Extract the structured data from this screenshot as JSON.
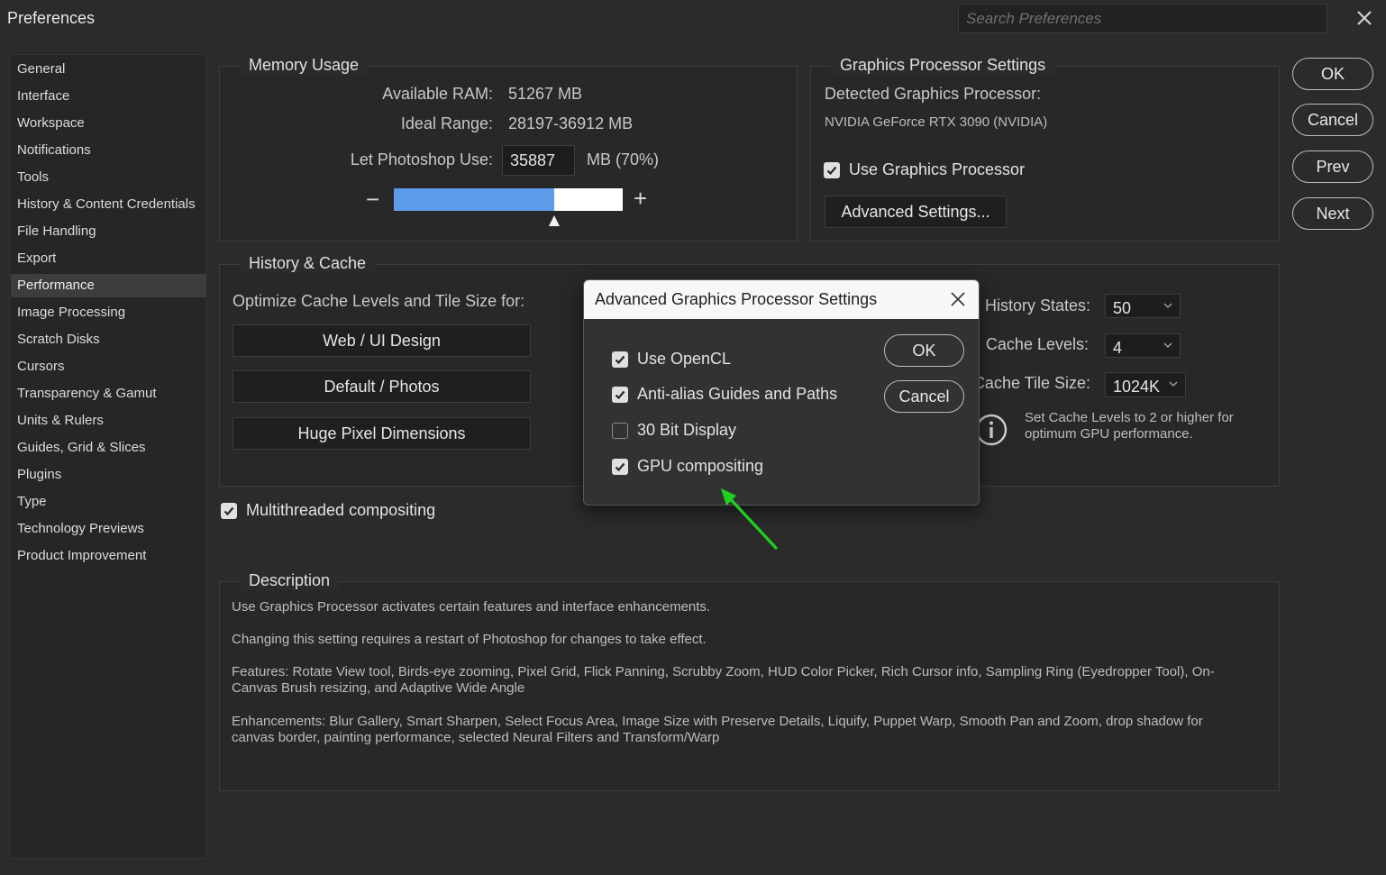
{
  "window": {
    "title": "Preferences",
    "search_placeholder": "Search Preferences"
  },
  "sidebar": {
    "items": [
      "General",
      "Interface",
      "Workspace",
      "Notifications",
      "Tools",
      "History & Content Credentials",
      "File Handling",
      "Export",
      "Performance",
      "Image Processing",
      "Scratch Disks",
      "Cursors",
      "Transparency & Gamut",
      "Units & Rulers",
      "Guides, Grid & Slices",
      "Plugins",
      "Type",
      "Technology Previews",
      "Product Improvement"
    ],
    "active": "Performance"
  },
  "memory": {
    "legend": "Memory Usage",
    "available_label": "Available RAM:",
    "available_value": "51267 MB",
    "ideal_label": "Ideal Range:",
    "ideal_value": "28197-36912 MB",
    "use_label": "Let Photoshop Use:",
    "use_value": "35887",
    "use_unit": "MB (70%)",
    "slider_fraction": 0.7,
    "minus": "−",
    "plus": "+"
  },
  "gpu": {
    "legend": "Graphics Processor Settings",
    "detected_label": "Detected Graphics Processor:",
    "detected_value": "NVIDIA GeForce RTX 3090 (NVIDIA)",
    "use_label": "Use Graphics Processor",
    "use_checked": true,
    "advanced_button": "Advanced Settings..."
  },
  "history_cache": {
    "legend": "History & Cache",
    "optimize_label": "Optimize Cache Levels and Tile Size for:",
    "presets": [
      "Web / UI Design",
      "Default / Photos",
      "Huge Pixel Dimensions"
    ],
    "history_states_label": "History States:",
    "history_states_value": "50",
    "cache_levels_label": "Cache Levels:",
    "cache_levels_value": "4",
    "tile_size_label": "Cache Tile Size:",
    "tile_size_value": "1024K",
    "info_text_1": "Set Cache Levels to 2 or higher for",
    "info_text_2": "optimum GPU performance."
  },
  "multithreaded": {
    "label": "Multithreaded compositing",
    "checked": true
  },
  "description": {
    "legend": "Description",
    "p1": "Use Graphics Processor activates certain features and interface enhancements.",
    "p2": "Changing this setting requires a restart of Photoshop for changes to take effect.",
    "p3": "Features: Rotate View tool, Birds-eye zooming, Pixel Grid, Flick Panning, Scrubby Zoom, HUD Color Picker, Rich Cursor info, Sampling Ring (Eyedropper Tool), On-Canvas Brush resizing, and Adaptive Wide Angle",
    "p4": "Enhancements: Blur Gallery, Smart Sharpen, Select Focus Area, Image Size with Preserve Details, Liquify, Puppet Warp, Smooth Pan and Zoom, drop shadow for canvas border, painting performance, selected Neural Filters and Transform/Warp"
  },
  "buttons": {
    "ok": "OK",
    "cancel": "Cancel",
    "prev": "Prev",
    "next": "Next"
  },
  "modal": {
    "title": "Advanced Graphics Processor Settings",
    "options": [
      {
        "label": "Use OpenCL",
        "checked": true
      },
      {
        "label": "Anti-alias Guides and Paths",
        "checked": true
      },
      {
        "label": "30 Bit Display",
        "checked": false
      },
      {
        "label": "GPU compositing",
        "checked": true
      }
    ],
    "ok": "OK",
    "cancel": "Cancel"
  },
  "colors": {
    "slider_fill": "#5b9bea",
    "annotation_arrow": "#1fd11f"
  }
}
